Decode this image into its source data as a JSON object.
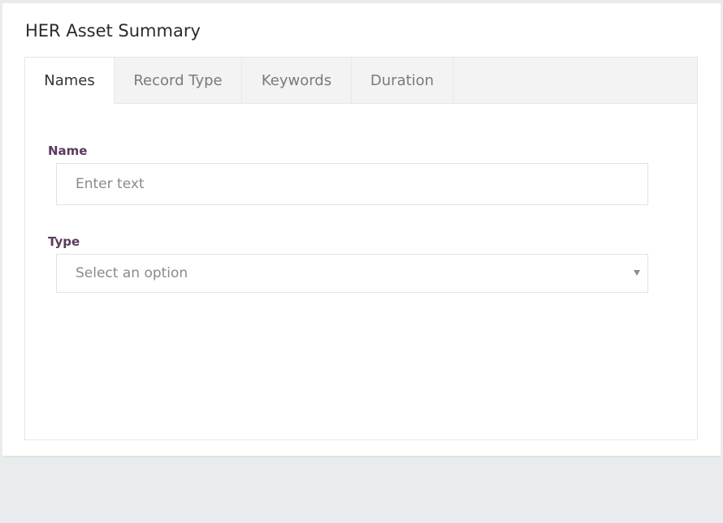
{
  "card": {
    "title": "HER Asset Summary"
  },
  "tabs": [
    {
      "label": "Names",
      "active": true
    },
    {
      "label": "Record Type",
      "active": false
    },
    {
      "label": "Keywords",
      "active": false
    },
    {
      "label": "Duration",
      "active": false
    }
  ],
  "form": {
    "name": {
      "label": "Name",
      "placeholder": "Enter text",
      "value": ""
    },
    "type": {
      "label": "Type",
      "placeholder": "Select an option",
      "selected": ""
    }
  },
  "colors": {
    "label": "#5b3a5e",
    "page_background": "#e9ecee",
    "tab_inactive_bg": "#f3f3f3"
  },
  "icons": {
    "select_caret": "chevron-down-icon"
  }
}
